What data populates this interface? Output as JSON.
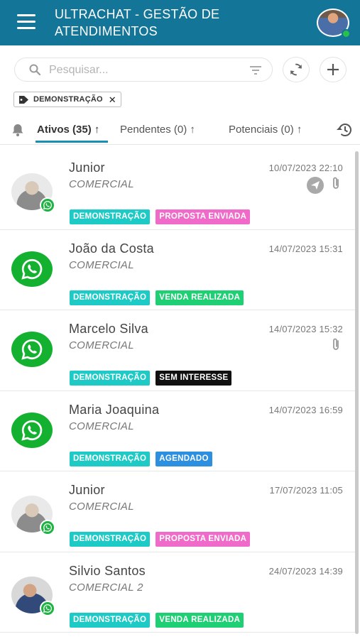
{
  "header": {
    "title": "ULTRACHAT - GESTÃO DE ATENDIMENTOS"
  },
  "search": {
    "placeholder": "Pesquisar..."
  },
  "filter_chip": {
    "label": "DEMONSTRAÇÃO",
    "close": "✕"
  },
  "tabs": [
    {
      "label": "Ativos (35) ↑",
      "active": true
    },
    {
      "label": "Pendentes (0) ↑",
      "active": false
    },
    {
      "label": "Potenciais (0) ↑",
      "active": false
    }
  ],
  "colors": {
    "header_bg": "#137597",
    "tag_demo": "#1ecac6",
    "tag_proposta": "#f06ac9",
    "tag_venda": "#1fcf73",
    "tag_sem_interesse": "#111111",
    "tag_agendado": "#2d8fe0"
  },
  "conversations": [
    {
      "name": "Junior",
      "department": "COMERCIAL",
      "datetime": "10/07/2023 22:10",
      "avatar": "photo",
      "icons": [
        "send-icon",
        "attachment-icon"
      ],
      "tags": [
        {
          "label": "DEMONSTRAÇÃO",
          "color": "#1ecac6"
        },
        {
          "label": "PROPOSTA ENVIADA",
          "color": "#f06ac9"
        }
      ]
    },
    {
      "name": "João da Costa",
      "department": "COMERCIAL",
      "datetime": "14/07/2023 15:31",
      "avatar": "whatsapp",
      "icons": [],
      "tags": [
        {
          "label": "DEMONSTRAÇÃO",
          "color": "#1ecac6"
        },
        {
          "label": "VENDA REALIZADA",
          "color": "#1fcf73"
        }
      ]
    },
    {
      "name": "Marcelo Silva",
      "department": "COMERCIAL",
      "datetime": "14/07/2023 15:32",
      "avatar": "whatsapp",
      "icons": [
        "attachment-icon"
      ],
      "tags": [
        {
          "label": "DEMONSTRAÇÃO",
          "color": "#1ecac6"
        },
        {
          "label": "SEM INTERESSE",
          "color": "#111111"
        }
      ]
    },
    {
      "name": "Maria Joaquina",
      "department": "COMERCIAL",
      "datetime": "14/07/2023 16:59",
      "avatar": "whatsapp",
      "icons": [],
      "tags": [
        {
          "label": "DEMONSTRAÇÃO",
          "color": "#1ecac6"
        },
        {
          "label": "AGENDADO",
          "color": "#2d8fe0"
        }
      ]
    },
    {
      "name": "Junior",
      "department": "COMERCIAL",
      "datetime": "17/07/2023 11:05",
      "avatar": "photo",
      "icons": [],
      "tags": [
        {
          "label": "DEMONSTRAÇÃO",
          "color": "#1ecac6"
        },
        {
          "label": "PROPOSTA ENVIADA",
          "color": "#f06ac9"
        }
      ]
    },
    {
      "name": "Silvio Santos",
      "department": "COMERCIAL 2",
      "datetime": "24/07/2023 14:39",
      "avatar": "photo2",
      "icons": [],
      "tags": [
        {
          "label": "DEMONSTRAÇÃO",
          "color": "#1ecac6"
        },
        {
          "label": "VENDA REALIZADA",
          "color": "#1fcf73"
        }
      ]
    }
  ]
}
